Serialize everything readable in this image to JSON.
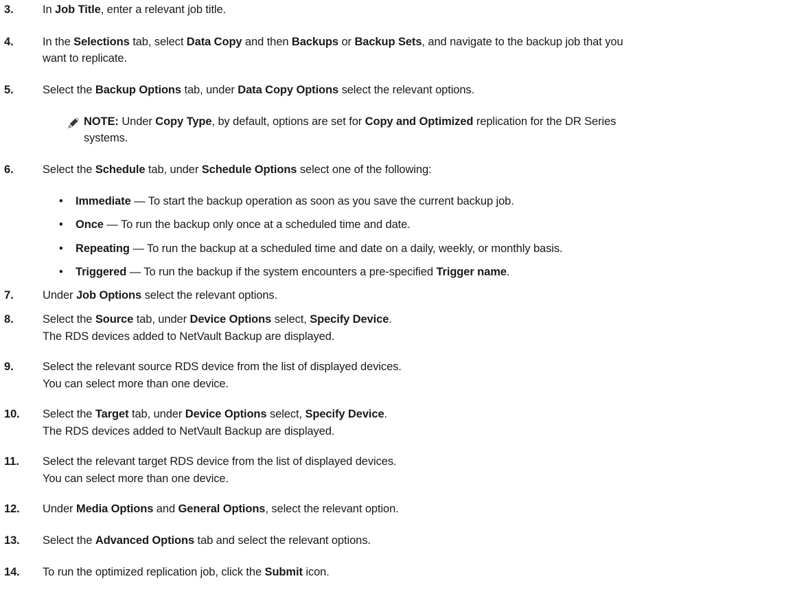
{
  "steps": {
    "s3": {
      "num": "3.",
      "a": "In ",
      "b": "Job Title",
      "c": ", enter a relevant job title."
    },
    "s4": {
      "num": "4.",
      "a": "In the ",
      "b": "Selections",
      "c": " tab, select ",
      "d": "Data Copy",
      "e": " and then ",
      "f": "Backups",
      "g": " or ",
      "h": "Backup Sets",
      "i": ", and navigate to the backup job that you",
      "cont": "want to replicate."
    },
    "s5": {
      "num": "5.",
      "a": "Select the ",
      "b": "Backup Options",
      "c": " tab, under ",
      "d": "Data Copy Options",
      "e": " select the relevant options."
    },
    "note": {
      "label": "NOTE:",
      "a": " Under ",
      "b": "Copy Type",
      "c": ", by default, options are set for ",
      "d": "Copy and Optimized",
      "e": " replication for the DR Series",
      "cont": "systems."
    },
    "s6": {
      "num": "6.",
      "a": "Select the ",
      "b": "Schedule",
      "c": " tab, under ",
      "d": "Schedule Options",
      "e": " select one of the following:"
    },
    "bullets": [
      {
        "dot": "•",
        "term": "Immediate",
        "text": " — To start the backup operation as soon as you save the current backup job."
      },
      {
        "dot": "•",
        "term": "Once",
        "text": " — To run the backup only once at a scheduled time and date."
      },
      {
        "dot": "•",
        "term": "Repeating",
        "text": " — To run the backup at a scheduled time and date on a daily, weekly, or monthly basis."
      },
      {
        "dot": "•",
        "term": "Triggered",
        "text": " — To run the backup if the system encounters a pre-specified ",
        "term2": "Trigger name",
        "end": "."
      }
    ],
    "s7": {
      "num": "7.",
      "a": "Under ",
      "b": "Job Options",
      "c": " select the relevant options."
    },
    "s8": {
      "num": "8.",
      "a": "Select the ",
      "b": "Source",
      "c": " tab, under ",
      "d": "Device Options",
      "e": " select, ",
      "f": "Specify Device",
      "g": ".",
      "sub": "The RDS devices added to NetVault Backup are displayed."
    },
    "s9": {
      "num": "9.",
      "a": "Select the relevant source RDS device from the list of displayed devices.",
      "sub": "You can select more than one device."
    },
    "s10": {
      "num": "10.",
      "a": "Select the ",
      "b": "Target",
      "c": " tab, under ",
      "d": "Device Options",
      "e": " select, ",
      "f": "Specify Device",
      "g": ".",
      "sub": "The RDS devices added to NetVault Backup are displayed."
    },
    "s11": {
      "num": "11.",
      "a": "Select the relevant target RDS device from the list of displayed devices.",
      "sub": "You can select more than one device."
    },
    "s12": {
      "num": "12.",
      "a": "Under ",
      "b": "Media Options",
      "c": " and ",
      "d": "General Options",
      "e": ", select the relevant option."
    },
    "s13": {
      "num": "13.",
      "a": "Select the ",
      "b": "Advanced Options",
      "c": " tab and select the relevant options."
    },
    "s14": {
      "num": "14.",
      "a": "To run the optimized replication job, click the ",
      "b": "Submit",
      "c": " icon."
    }
  }
}
